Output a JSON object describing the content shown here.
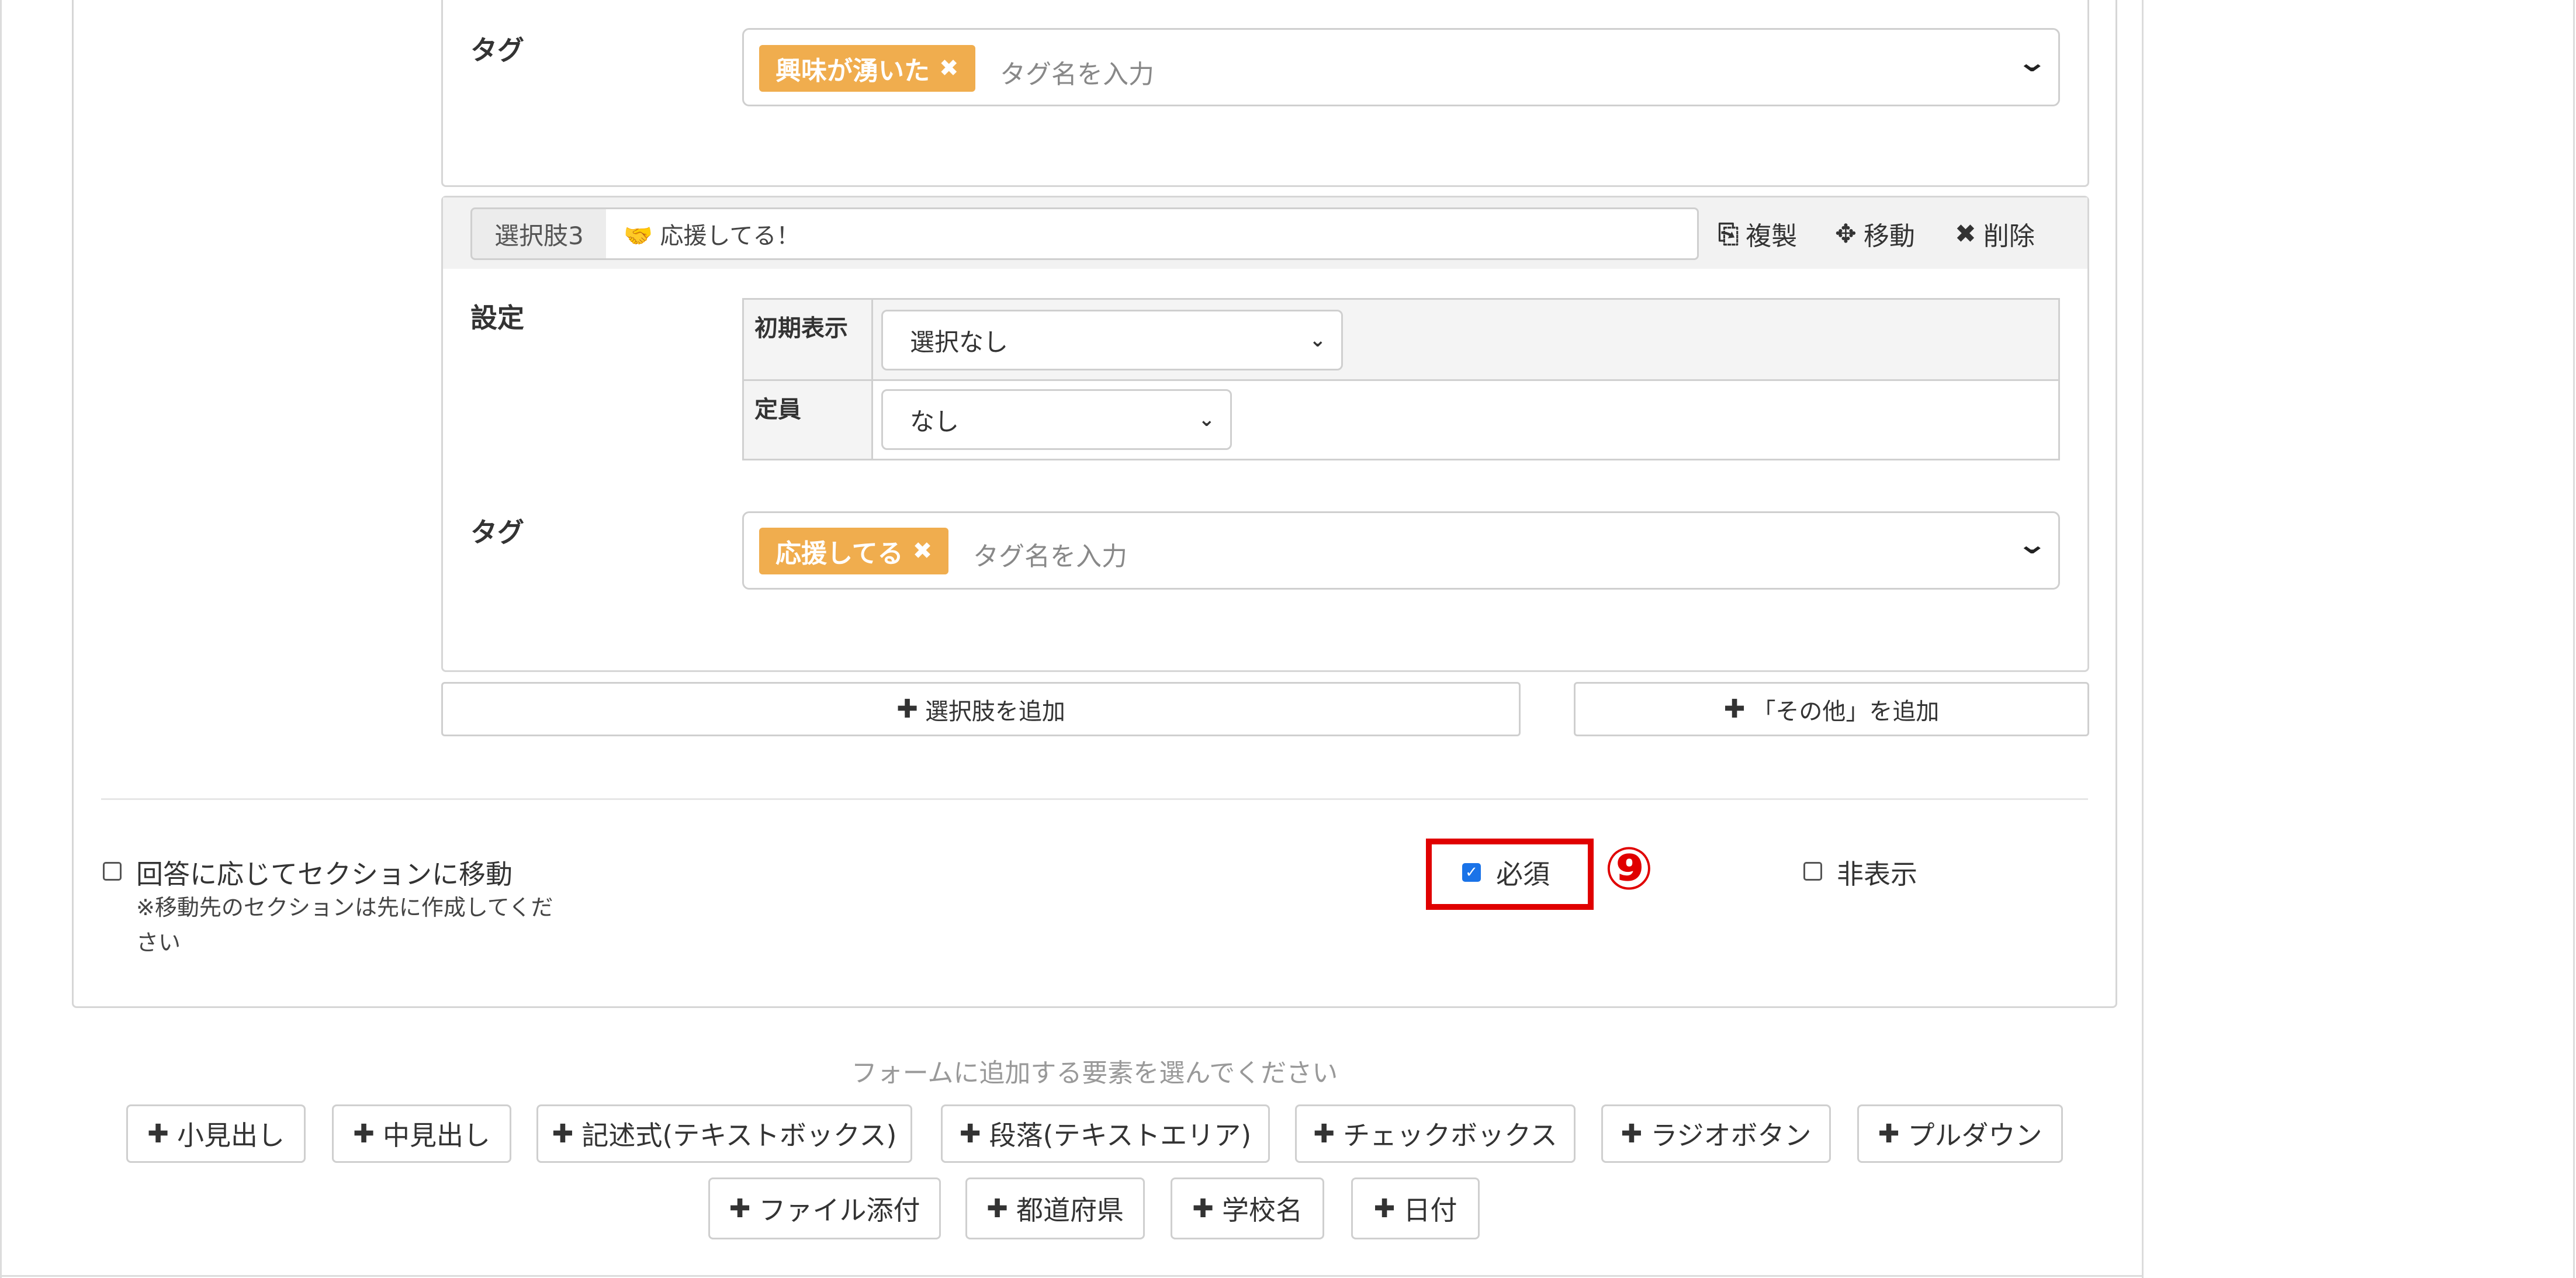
{
  "choices": [
    {
      "tags_label": "タグ",
      "tag_chip": "興味が湧いた",
      "tag_placeholder": "タグ名を入力"
    },
    {
      "addon_label": "選択肢3",
      "text": "🤝 応援してる！",
      "actions": {
        "duplicate": "複製",
        "move": "移動",
        "delete": "削除"
      },
      "settings_label": "設定",
      "initial_label": "初期表示",
      "initial_value": "選択なし",
      "capacity_label": "定員",
      "capacity_value": "なし",
      "tags_label": "タグ",
      "tag_chip": "応援してる",
      "tag_placeholder": "タグ名を入力"
    }
  ],
  "add_choice_label": "選択肢を追加",
  "add_other_label": "「その他」を追加",
  "options": {
    "section_jump_label": "回答に応じてセクションに移動",
    "section_jump_note": "※移動先のセクションは先に作成してください",
    "section_jump_checked": false,
    "required_label": "必須",
    "required_checked": true,
    "hidden_label": "非表示",
    "hidden_checked": false,
    "step_marker": "⑨"
  },
  "palette": {
    "hint": "フォームに追加する要素を選んでください",
    "row1": [
      "小見出し",
      "中見出し",
      "記述式(テキストボックス)",
      "段落(テキストエリア)",
      "チェックボックス",
      "ラジオボタン",
      "プルダウン"
    ],
    "row2": [
      "ファイル添付",
      "都道府県",
      "学校名",
      "日付"
    ]
  },
  "colors": {
    "tag_chip": "#f0ad4e",
    "highlight": "#e00000",
    "checkbox_checked": "#1a73e8"
  }
}
